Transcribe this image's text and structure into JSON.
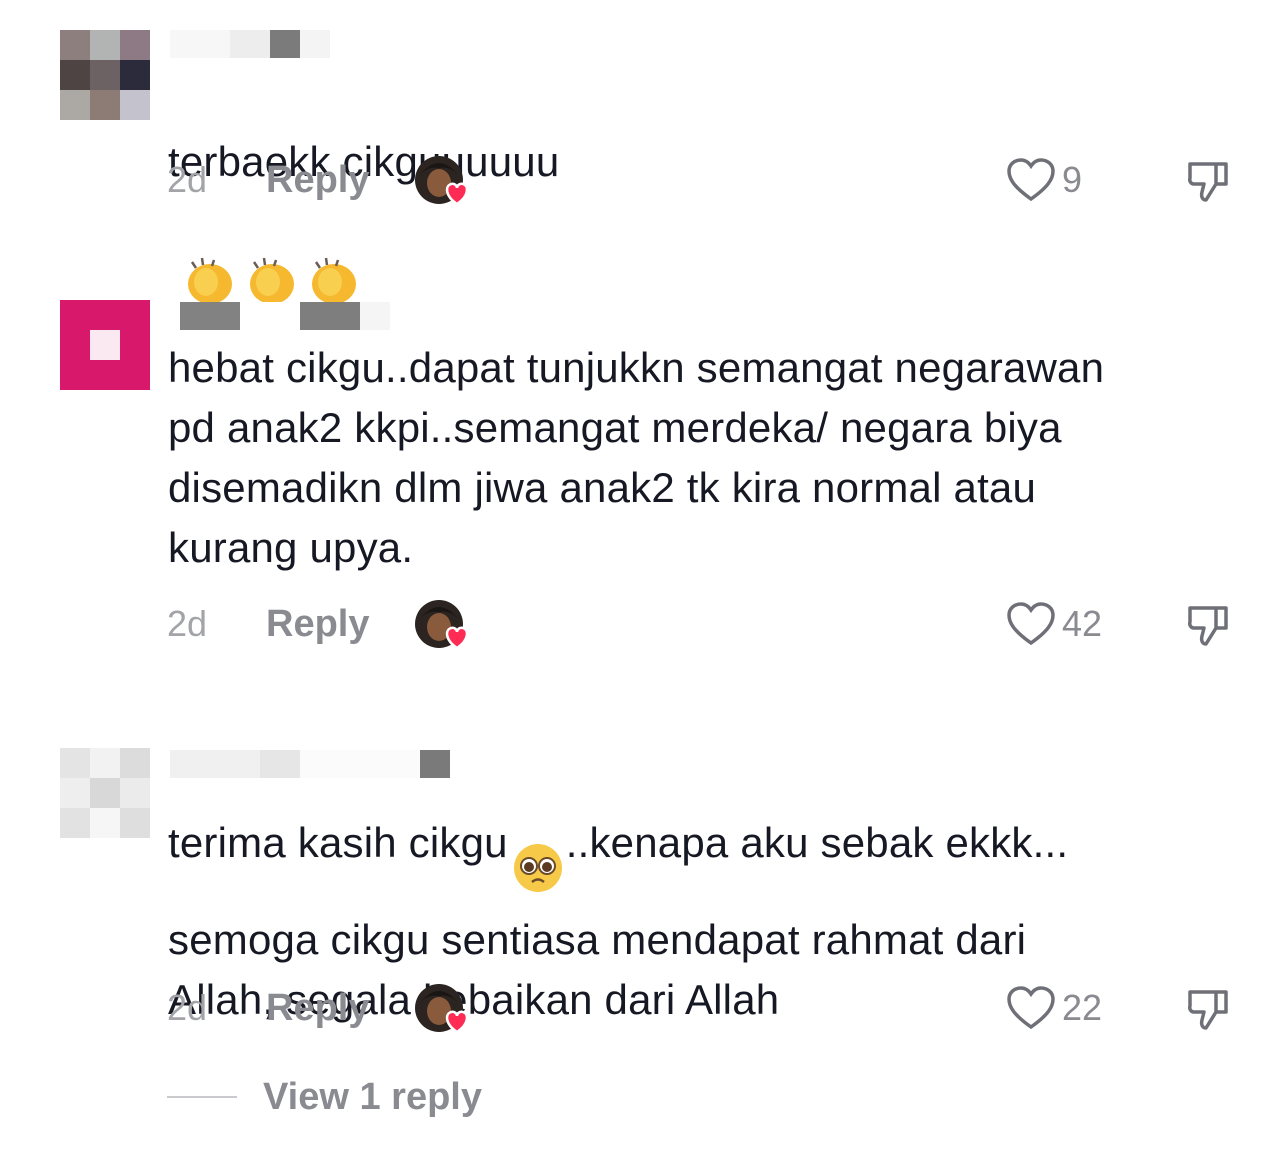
{
  "comments": [
    {
      "text": "terbaekk cikguuuuuu",
      "emoji_trailing": [
        "clapping-hands-emoji",
        "clapping-hands-emoji",
        "clapping-hands-emoji"
      ],
      "date": "2d",
      "reply_label": "Reply",
      "likes": "9",
      "creator_liked": true
    },
    {
      "text": "hebat cikgu..dapat tunjukkn semangat negarawan\npd anak2 kkpi..semangat merdeka/ negara biya\ndisemadikn dlm jiwa anak2 tk kira normal atau\nkurang upya.",
      "date": "2d",
      "reply_label": "Reply",
      "likes": "42",
      "creator_liked": true
    },
    {
      "text_before_emoji": "terima kasih cikgu",
      "inline_emoji": "pleading-face-emoji",
      "text_after_emoji": "..kenapa aku sebak ekkk...\nsemoga cikgu sentiasa mendapat rahmat dari\nAllah, segala kebaikan dari Allah",
      "date": "2d",
      "reply_label": "Reply",
      "likes": "22",
      "creator_liked": true
    }
  ],
  "view_replies_label": "View 1 reply",
  "colors": {
    "text": "#161823",
    "muted": "#8a8b91",
    "date": "#a3a4a8",
    "heart_badge": "#fe2c55",
    "avatar_pink": "#d8196b"
  }
}
